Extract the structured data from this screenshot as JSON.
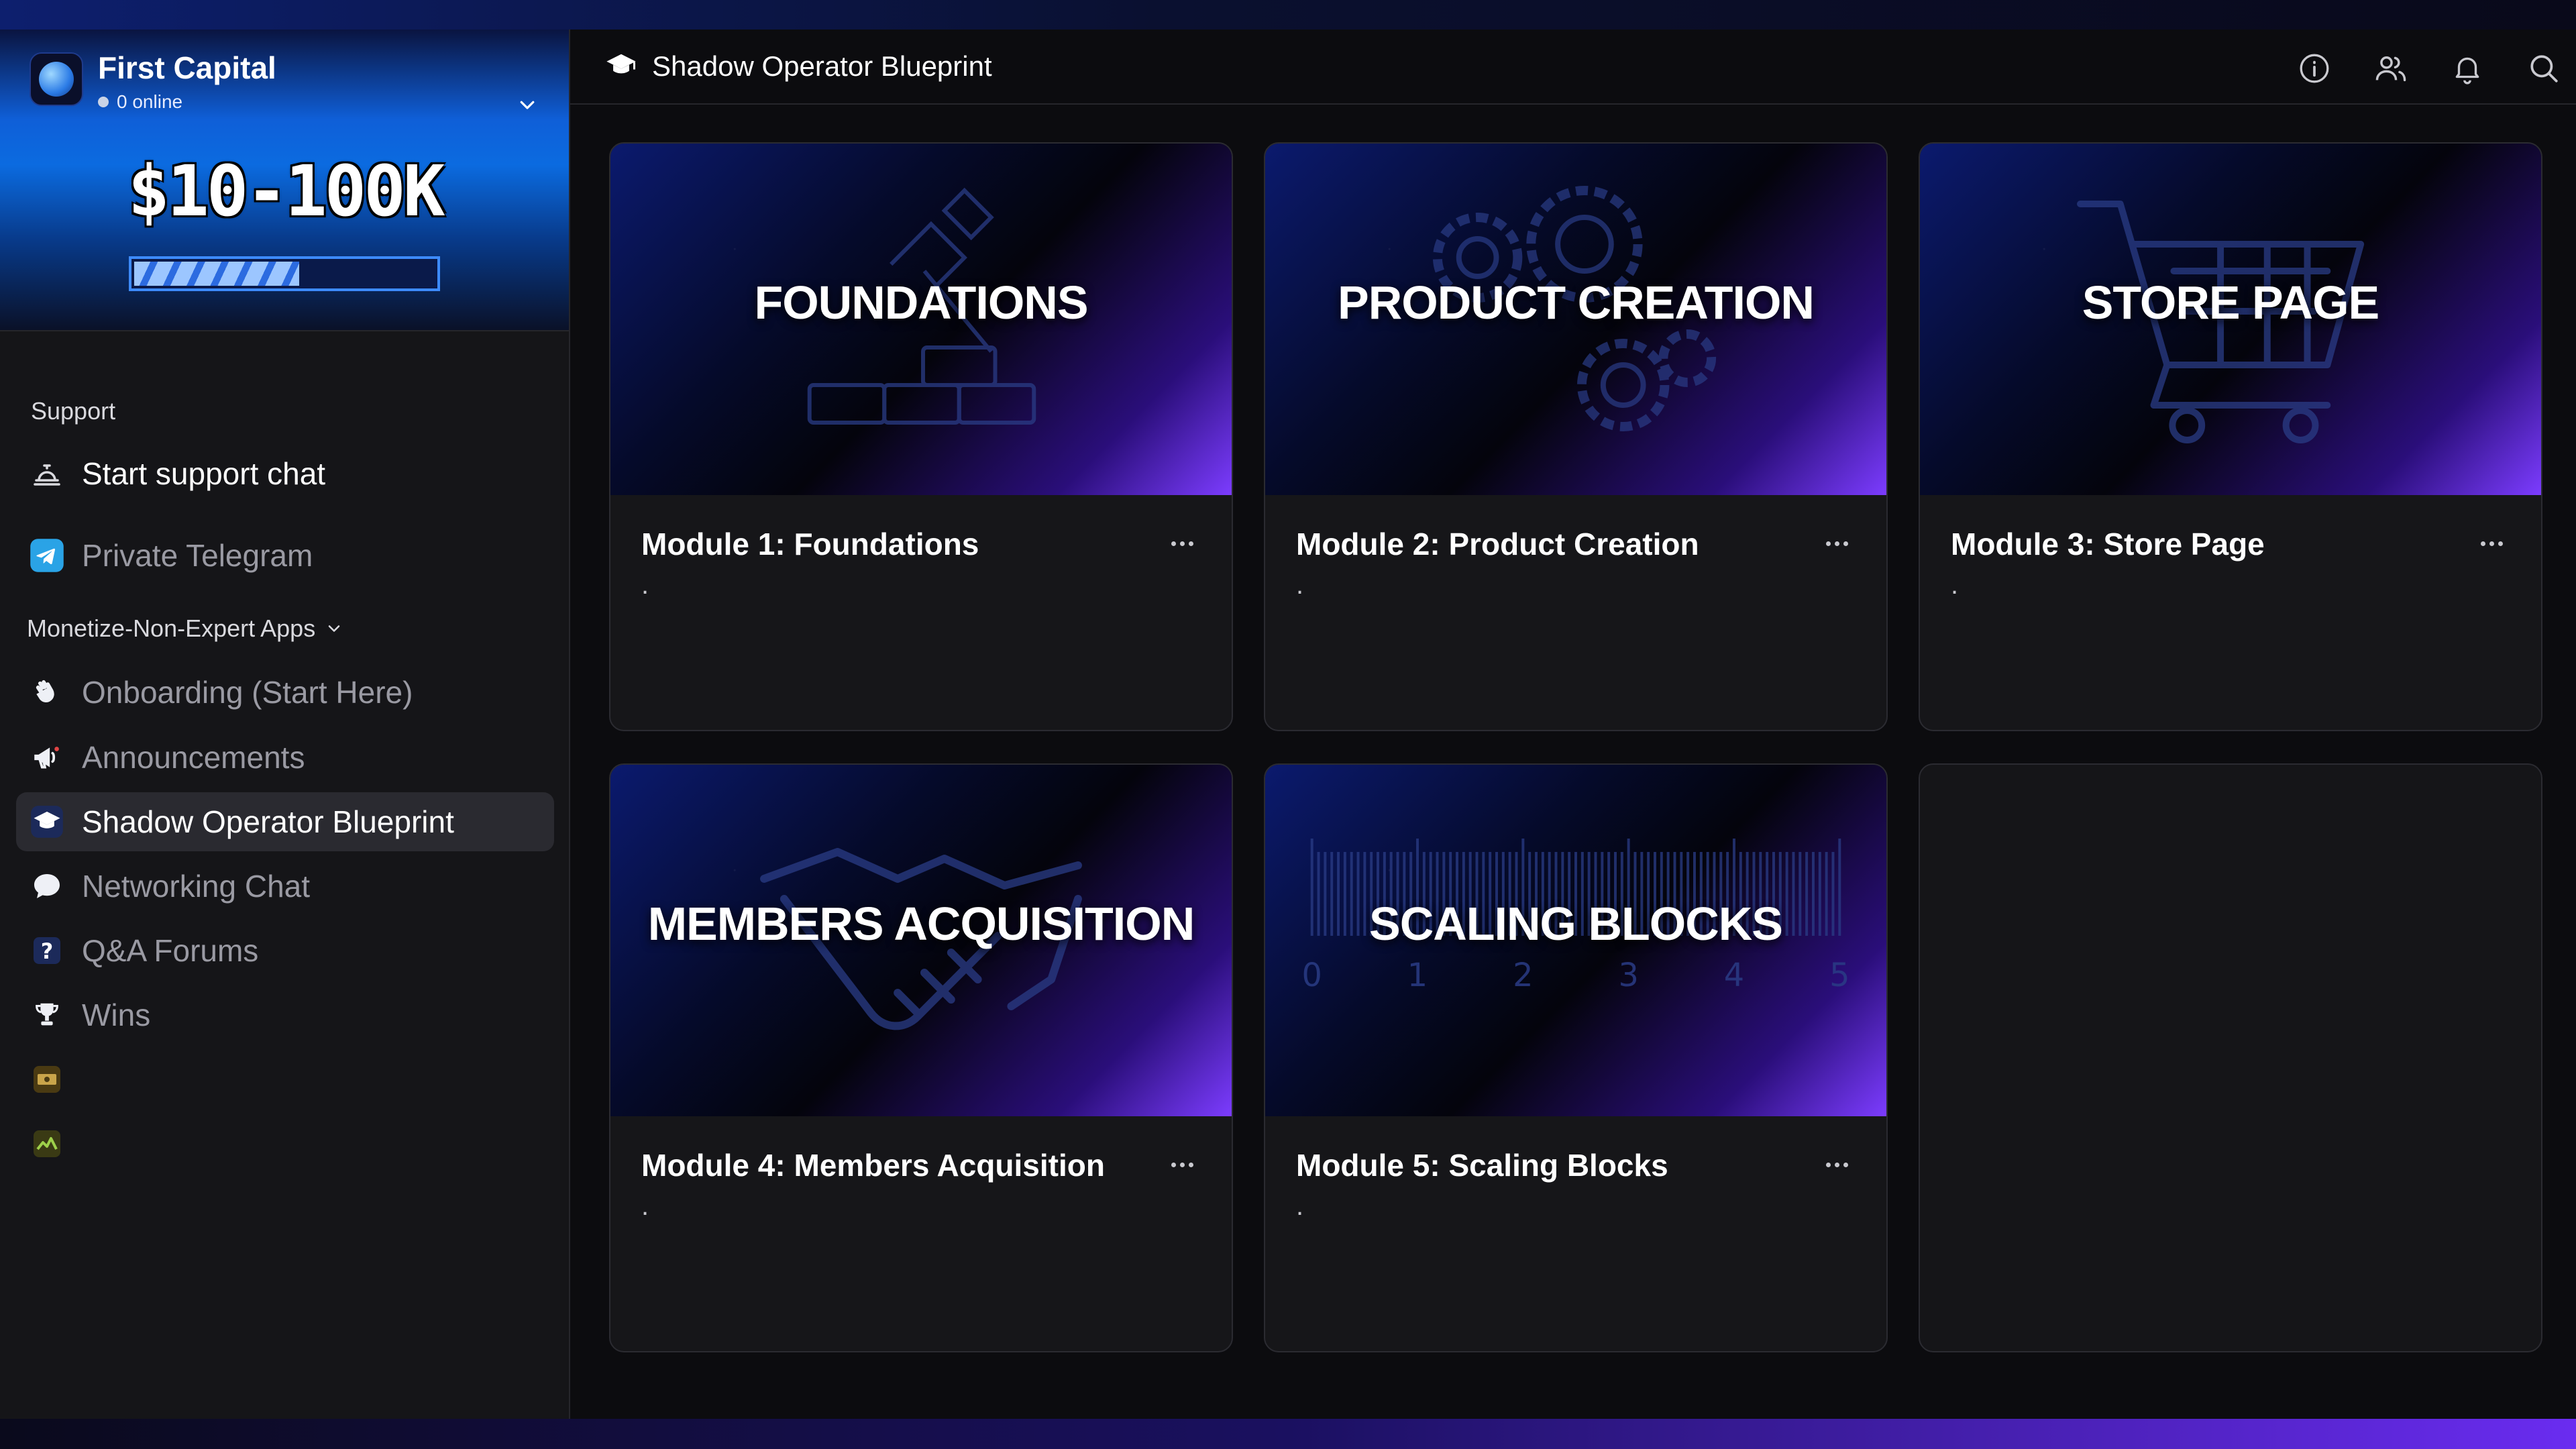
{
  "workspace": {
    "name": "First Capital",
    "online": "0 online",
    "banner_price": "$10-100K",
    "progress": 0.55
  },
  "sidebar": {
    "support_label": "Support",
    "support_chat": "Start support chat",
    "private_telegram": "Private Telegram",
    "group_label": "Monetize-Non-Expert Apps",
    "items": [
      {
        "label": "Onboarding (Start Here)",
        "icon": "waving-hand-icon"
      },
      {
        "label": "Announcements",
        "icon": "megaphone-icon"
      },
      {
        "label": "Shadow Operator Blueprint",
        "icon": "graduation-cap-icon"
      },
      {
        "label": "Networking Chat",
        "icon": "chat-bubble-icon"
      },
      {
        "label": "Q&A Forums",
        "icon": "question-icon"
      },
      {
        "label": "Wins",
        "icon": "trophy-icon"
      }
    ]
  },
  "header": {
    "title": "Shadow Operator Blueprint",
    "icons": [
      "info-icon",
      "members-icon",
      "bell-icon",
      "search-icon"
    ]
  },
  "modules": [
    {
      "thumb": "FOUNDATIONS",
      "title": "Module 1: Foundations",
      "desc": "."
    },
    {
      "thumb": "PRODUCT CREATION",
      "title": "Module 2: Product Creation",
      "desc": "."
    },
    {
      "thumb": "STORE PAGE",
      "title": "Module 3: Store Page",
      "desc": "."
    },
    {
      "thumb": "MEMBERS ACQUISITION",
      "title": "Module 4: Members Acquisition",
      "desc": "."
    },
    {
      "thumb": "SCALING BLOCKS",
      "title": "Module 5: Scaling Blocks",
      "desc": "."
    }
  ],
  "ruler_ticks": [
    "0",
    "1",
    "2",
    "3",
    "4",
    "5"
  ],
  "colors": {
    "accent_blue": "#0b6be0",
    "accent_purple": "#7c3cff",
    "background": "#0c0c0f",
    "sidebar": "#151518"
  }
}
